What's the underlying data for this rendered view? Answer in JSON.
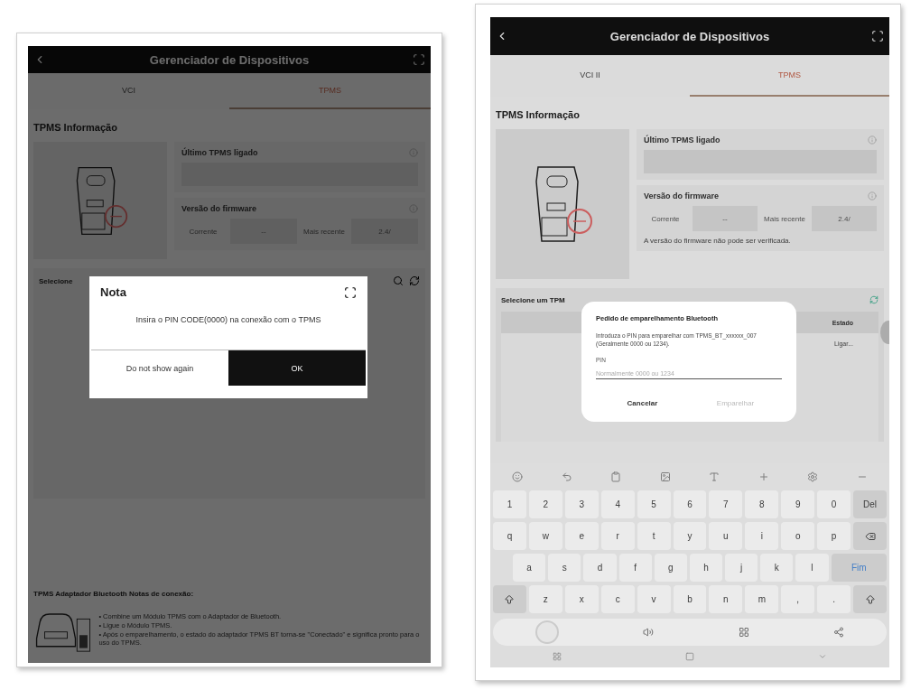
{
  "screens": [
    {
      "header": {
        "title": "Gerenciador de Dispositivos"
      },
      "tabs": [
        {
          "label": "VCI",
          "selected": false
        },
        {
          "label": "TPMS",
          "selected": true
        }
      ],
      "section_title": "TPMS Informação",
      "last_tpms": {
        "label": "Último TPMS ligado"
      },
      "firmware": {
        "label": "Versão do firmware",
        "current_label": "Corrente",
        "current_value": "--",
        "latest_label": "Mais recente",
        "latest_value": "2.4/"
      },
      "select": {
        "title": "Selecione"
      },
      "notes": {
        "title": "TPMS Adaptador Bluetooth Notas de conexão:",
        "items": [
          "• Combine um Módulo TPMS com o Adaptador de Bluetooth.",
          "• Ligue o Módulo TPMS.",
          "• Após o emparelhamento, o estado do adaptador TPMS BT torna-se \"Conectado\" e significa pronto para o uso do TPMS."
        ]
      },
      "dialog": {
        "kind": "note",
        "title": "Nota",
        "message": "Insira o PIN CODE(0000) na conexão com o TPMS",
        "buttons": [
          {
            "label": "Do not show again",
            "primary": false
          },
          {
            "label": "OK",
            "primary": true
          }
        ]
      }
    },
    {
      "header": {
        "title": "Gerenciador de Dispositivos"
      },
      "tabs": [
        {
          "label": "VCI II",
          "selected": false
        },
        {
          "label": "TPMS",
          "selected": true
        }
      ],
      "section_title": "TPMS Informação",
      "last_tpms": {
        "label": "Último TPMS ligado"
      },
      "firmware": {
        "label": "Versão do firmware",
        "current_label": "Corrente",
        "current_value": "--",
        "latest_label": "Mais recente",
        "latest_value": "2.4/",
        "message": "A versão do firmware não pode ser verificada."
      },
      "select": {
        "title": "Selecione um TPM",
        "column": "Estado",
        "row_status": "Ligar..."
      },
      "dialog": {
        "kind": "pairing",
        "title": "Pedido de emparelhamento Bluetooth",
        "message": "Introduza o PIN para emparelhar com TPMS_BT_xxxxxx_007 (Geralmente 0000 ou 1234).",
        "field": {
          "label": "PIN",
          "placeholder": "Normalmente 0000 ou 1234"
        },
        "buttons": [
          {
            "label": "Cancelar",
            "disabled": false
          },
          {
            "label": "Emparelhar",
            "disabled": true
          }
        ]
      },
      "keyboard": {
        "rows": [
          [
            {
              "kind": "char",
              "label": "1"
            },
            {
              "kind": "char",
              "label": "2"
            },
            {
              "kind": "char",
              "label": "3"
            },
            {
              "kind": "char",
              "label": "4"
            },
            {
              "kind": "char",
              "label": "5"
            },
            {
              "kind": "char",
              "label": "6"
            },
            {
              "kind": "char",
              "label": "7"
            },
            {
              "kind": "char",
              "label": "8"
            },
            {
              "kind": "char",
              "label": "9"
            },
            {
              "kind": "char",
              "label": "0"
            },
            {
              "kind": "action",
              "label": "Del"
            }
          ],
          [
            {
              "kind": "char",
              "label": "q"
            },
            {
              "kind": "char",
              "label": "w"
            },
            {
              "kind": "char",
              "label": "e"
            },
            {
              "kind": "char",
              "label": "r"
            },
            {
              "kind": "char",
              "label": "t"
            },
            {
              "kind": "char",
              "label": "y"
            },
            {
              "kind": "char",
              "label": "u"
            },
            {
              "kind": "char",
              "label": "i"
            },
            {
              "kind": "char",
              "label": "o"
            },
            {
              "kind": "char",
              "label": "p"
            },
            {
              "kind": "backspace"
            }
          ],
          [
            {
              "kind": "char",
              "label": "a"
            },
            {
              "kind": "char",
              "label": "s"
            },
            {
              "kind": "char",
              "label": "d"
            },
            {
              "kind": "char",
              "label": "f"
            },
            {
              "kind": "char",
              "label": "g"
            },
            {
              "kind": "char",
              "label": "h"
            },
            {
              "kind": "char",
              "label": "j"
            },
            {
              "kind": "char",
              "label": "k"
            },
            {
              "kind": "char",
              "label": "l"
            },
            {
              "kind": "enter",
              "label": "Fim"
            }
          ],
          [
            {
              "kind": "shift"
            },
            {
              "kind": "char",
              "label": "z"
            },
            {
              "kind": "char",
              "label": "x"
            },
            {
              "kind": "char",
              "label": "c"
            },
            {
              "kind": "char",
              "label": "v"
            },
            {
              "kind": "char",
              "label": "b"
            },
            {
              "kind": "char",
              "label": "n"
            },
            {
              "kind": "char",
              "label": "m"
            },
            {
              "kind": "char",
              "label": ","
            },
            {
              "kind": "char",
              "label": "."
            },
            {
              "kind": "shift"
            }
          ]
        ]
      }
    }
  ]
}
